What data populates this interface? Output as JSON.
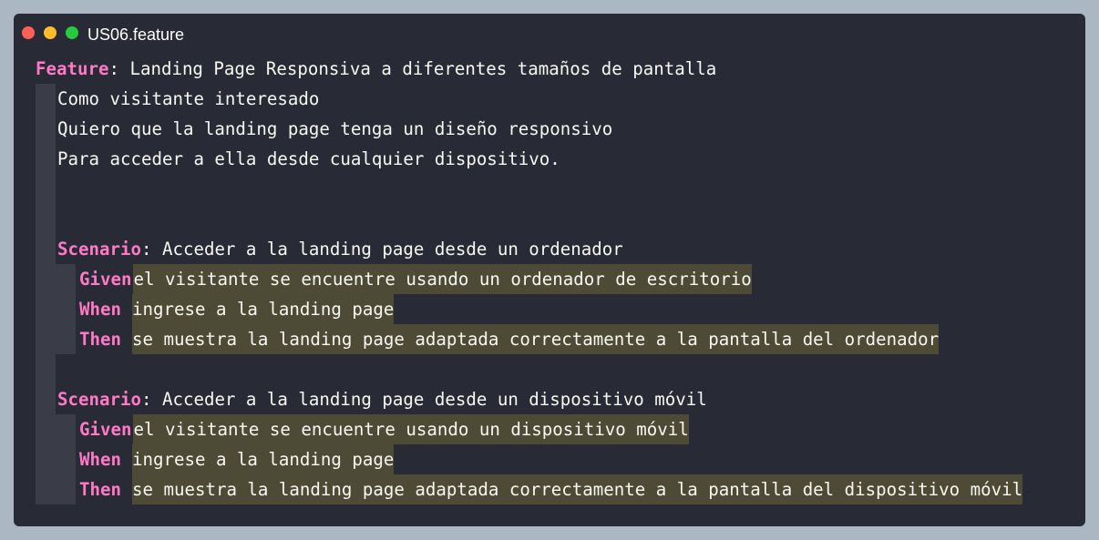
{
  "window": {
    "filename": "US06.feature",
    "controls": {
      "close_color": "#ff5f56",
      "minimize_color": "#ffbd2e",
      "maximize_color": "#27c93f"
    }
  },
  "colors": {
    "keyword": "#ff79c6",
    "text": "#f8f8f2",
    "step_highlight": "#4d4a35",
    "indent_guide": "#3a3d47",
    "background": "#282a36",
    "page_background": "#abb8c3"
  },
  "feature": {
    "keyword": "Feature",
    "separator": ":",
    "title": " Landing Page Responsiva a diferentes tamaños de pantalla",
    "description": [
      "Como visitante interesado",
      "Quiero que la landing page tenga un diseño responsivo",
      "Para acceder a ella desde cualquier dispositivo."
    ]
  },
  "scenarios": [
    {
      "keyword": "Scenario",
      "separator": ":",
      "title": " Acceder a la landing page desde un ordenador",
      "steps": [
        {
          "keyword": "Given",
          "text": "el visitante se encuentre usando un ordenador de escritorio"
        },
        {
          "keyword": "When",
          "text": "ingrese a la landing page"
        },
        {
          "keyword": "Then",
          "text": "se muestra la landing page adaptada correctamente a la pantalla del ordenador"
        }
      ]
    },
    {
      "keyword": "Scenario",
      "separator": ":",
      "title": " Acceder a la landing page desde un dispositivo móvil",
      "steps": [
        {
          "keyword": "Given",
          "text": "el visitante se encuentre usando un dispositivo móvil"
        },
        {
          "keyword": "When",
          "text": "ingrese a la landing page"
        },
        {
          "keyword": "Then",
          "text": "se muestra la landing page adaptada correctamente a la pantalla del dispositivo móvil"
        }
      ]
    }
  ]
}
